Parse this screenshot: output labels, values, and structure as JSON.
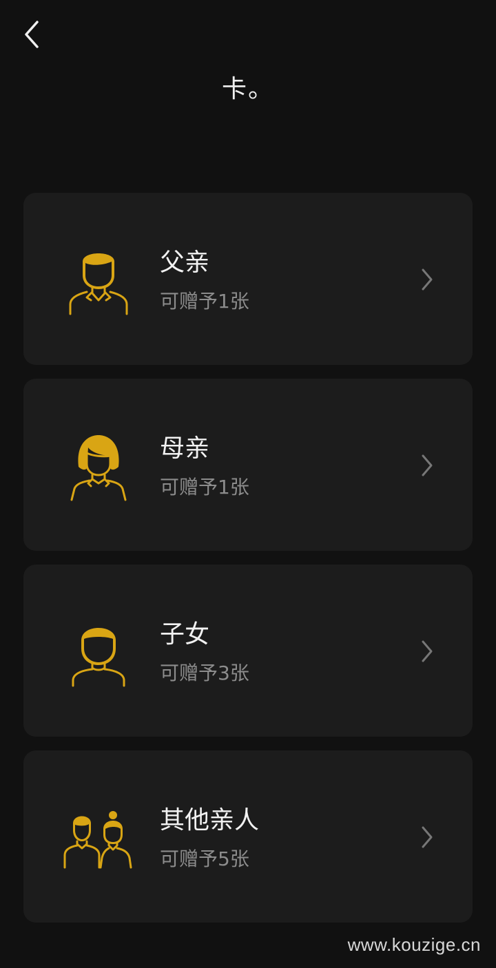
{
  "header": {
    "back_icon": "chevron-left-icon",
    "title": "卡。"
  },
  "colors": {
    "background": "#111111",
    "card": "#1c1c1c",
    "accent": "#d9a514",
    "secondary_text": "#8c8c8c"
  },
  "items": [
    {
      "name": "父亲",
      "subtitle": "可赠予1张",
      "icon": "father-icon"
    },
    {
      "name": "母亲",
      "subtitle": "可赠予1张",
      "icon": "mother-icon"
    },
    {
      "name": "子女",
      "subtitle": "可赠予3张",
      "icon": "child-icon"
    },
    {
      "name": "其他亲人",
      "subtitle": "可赠予5张",
      "icon": "relatives-icon"
    }
  ],
  "watermark": "www.kouzige.cn"
}
